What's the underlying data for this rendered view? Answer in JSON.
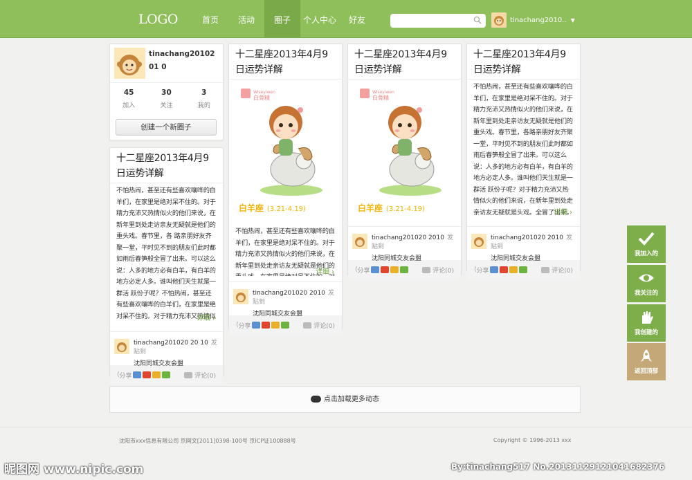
{
  "header": {
    "logo": "LOGO",
    "nav": [
      "首页",
      "活动",
      "圈子",
      "个人中心",
      "好友"
    ],
    "active": 2,
    "user": "tinachang2010.."
  },
  "profile": {
    "name": "tinachang2010201 0",
    "stats": [
      {
        "n": "45",
        "l": "加入"
      },
      {
        "n": "30",
        "l": "关注"
      },
      {
        "n": "3",
        "l": "我的"
      }
    ],
    "create": "创建一个新圈子"
  },
  "posts": {
    "title": "十二星座2013年4月9日运势详解",
    "body_full": "不怕热闹，甚至还有些喜欢嚷哗的白羊们，在家里是绝对呆不住的。对于精力充沛又热情似火的他们来说，在新年里到处走访亲友无疑就是他们的重头戏。春节里，各 路亲朋好友齐聚一堂，平时见不到的朋友们此时都如雨后春笋般全冒了出来。可以这么说：人多的地方必有白羊，有白羊的地方必定人多。谁叫他们天生就是一群活 跃份子呢？不怕热闹，甚至还有些喜欢嚷哗的白羊们，在家里是绝对呆不住的。对于精力充沛又热情似火的他们来说，在新年里到处走亲访友无疑就是呢？. . .",
    "body_short": "不怕热闹，甚至还有些喜欢嚷哗的白羊们，在家里是绝对呆不住的。对于精力充沛又热情似火的他们来说，在新年里到处走亲访友无疑就是他们的重头戏。在家里是绝对呆不住的。对于精力充沛又热情似火的他们来说，在新年里到处走亲访友无疑就是活份子呢？. . .",
    "body_mid": "不怕热闹，甚至还有些喜欢嚷哗的白羊们，在家里是绝对呆不住的。对于精力充沛又热情似火的他们来说，在新年里到处走亲访友无疑就是他们的重头戏。春节里，各路亲朋好友齐聚一堂，平时见不到的朋友们此时都如雨后春笋般全冒了出来。可以这么说：人多的地方必有白羊，有白羊的地方必定人多。谁叫他们天生就是一群活 跃份子呢？对于精力充沛又热情似火的他们来说，在新年里到处走亲访友无疑就是头戏。全冒了出来。平时，各路亲朋好友齐聚一堂，平时见不到的朋友们. . .",
    "detail": "详细 ›",
    "author": "tinachang201020 2010",
    "author2": "tinachang201020 20 10",
    "posted": "发贴到",
    "group": "沈阳同城交友会盟",
    "share": "分享",
    "comment": "评论(0)",
    "sign_label": "白羊座",
    "sign_dates": "(3.21-4.19)",
    "brand": "白骨精"
  },
  "side": [
    "我加入的",
    "我关注的",
    "我创建的",
    "返回顶部"
  ],
  "load_more": "点击加载更多动态",
  "footer": {
    "left": "沈阳市xxx信息有限公司  京网文[2011]0398-100号  京ICP证100888号",
    "right": "Copyright © 1996-2013 xxx"
  },
  "watermark": {
    "left": "昵图网 www.nipic.com",
    "right": "By:tinachang517  No.20131129121041682376"
  }
}
